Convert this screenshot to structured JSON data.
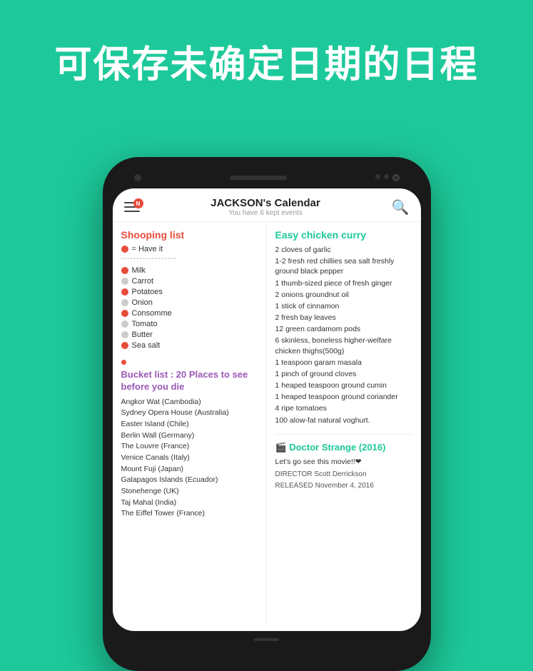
{
  "hero": {
    "text": "可保存未确定日期的日程"
  },
  "phone": {
    "header": {
      "title": "JACKSON's Calendar",
      "subtitle": "You have 6 kept events",
      "notification": "N"
    },
    "left": {
      "shoppingTitle": "Shooping list",
      "legendHave": "= Have it",
      "divider": "------------------",
      "items": [
        {
          "dot": "red",
          "text": "Milk"
        },
        {
          "dot": "gray",
          "text": "Carrot"
        },
        {
          "dot": "red",
          "text": "Potatoes"
        },
        {
          "dot": "gray",
          "text": "Onion"
        },
        {
          "dot": "red",
          "text": "Consomme"
        },
        {
          "dot": "gray",
          "text": "Tomato"
        },
        {
          "dot": "gray",
          "text": "Butter"
        },
        {
          "dot": "red",
          "text": "Sea salt"
        }
      ],
      "bucketTitle": "Bucket list : 20 Places to see before you die",
      "bucketItems": [
        "Angkor Wat (Cambodia)",
        "Sydney Opera House (Australia)",
        "Easter Island (Chile)",
        "Berlin Wall (Germany)",
        "The Louvre (France)",
        "Venice Canals (Italy)",
        "Mount Fuji (Japan)",
        "Galapagos Islands (Ecuador)",
        "Stonehenge (UK)",
        "Taj Mahal (India)",
        "The Eiffel Tower (France)"
      ]
    },
    "right": {
      "recipeTitle": "Easy chicken curry",
      "recipeItems": [
        "2 cloves of garlic",
        "1-2 fresh red chillies sea salt freshly ground black pepper",
        "1 thumb-sized piece of fresh ginger",
        "2 onions groundnut oil",
        "1 stick of cinnamon",
        "2 fresh bay leaves",
        "12 green cardamom pods",
        "6 skinless, boneless higher-welfare chicken thighs(500g)",
        "1 teaspoon garam masala",
        "1 pinch of ground cloves",
        "1 heaped teaspoon ground cumin",
        "1 heaped teaspoon ground coriander",
        "4 ripe tomatoes",
        "100  alow-fat natural voghurt."
      ],
      "movieTitle": "Doctor Strange (2016)",
      "movieEmoji": "🎬",
      "movieDesc": "Let's go see this movie!!❤",
      "movieMeta1": "DIRECTOR Scott Derrickson",
      "movieMeta2": "RELEASED November 4, 2016"
    }
  }
}
